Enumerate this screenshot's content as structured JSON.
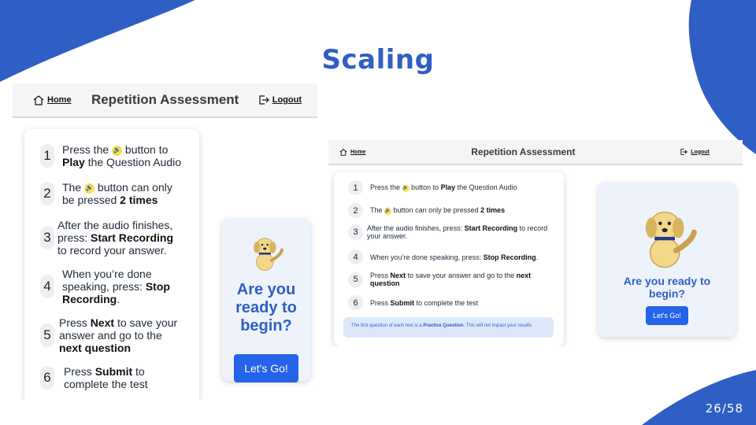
{
  "slide": {
    "title": "Scaling",
    "page": "26/58"
  },
  "screen": {
    "home_label": "Home",
    "title": "Repetition Assessment",
    "logout_label": "Logout",
    "steps": [
      {
        "num": "1",
        "a": "Press the",
        "b": "button to",
        "c": "Play",
        "d": "the Question Audio"
      },
      {
        "num": "2",
        "a": "The",
        "b": "button can only be pressed",
        "c": "2 times"
      },
      {
        "num": "3",
        "a": "After the audio finishes, press:",
        "b": "Start Recording",
        "c": "to record your answer."
      },
      {
        "num": "4",
        "a": "When you’re done speaking, press:",
        "b": "Stop Recording",
        "c": "."
      },
      {
        "num": "5",
        "a": "Press",
        "b": "Next",
        "c": "to save your answer and go to the",
        "d": "next question"
      },
      {
        "num": "6",
        "a": "Press",
        "b": "Submit",
        "c": "to complete the test"
      }
    ],
    "ready_text": "Are you ready to begin?",
    "go_button": "Let's Go!",
    "note": {
      "a": "The first question of each test is a",
      "b": "Practice Question",
      "c": ". This will not impact your results"
    }
  },
  "colors": {
    "accent": "#2f5ec4",
    "button": "#2563eb",
    "speaker": "#fde047",
    "ready_bg": "#eef3fb"
  }
}
